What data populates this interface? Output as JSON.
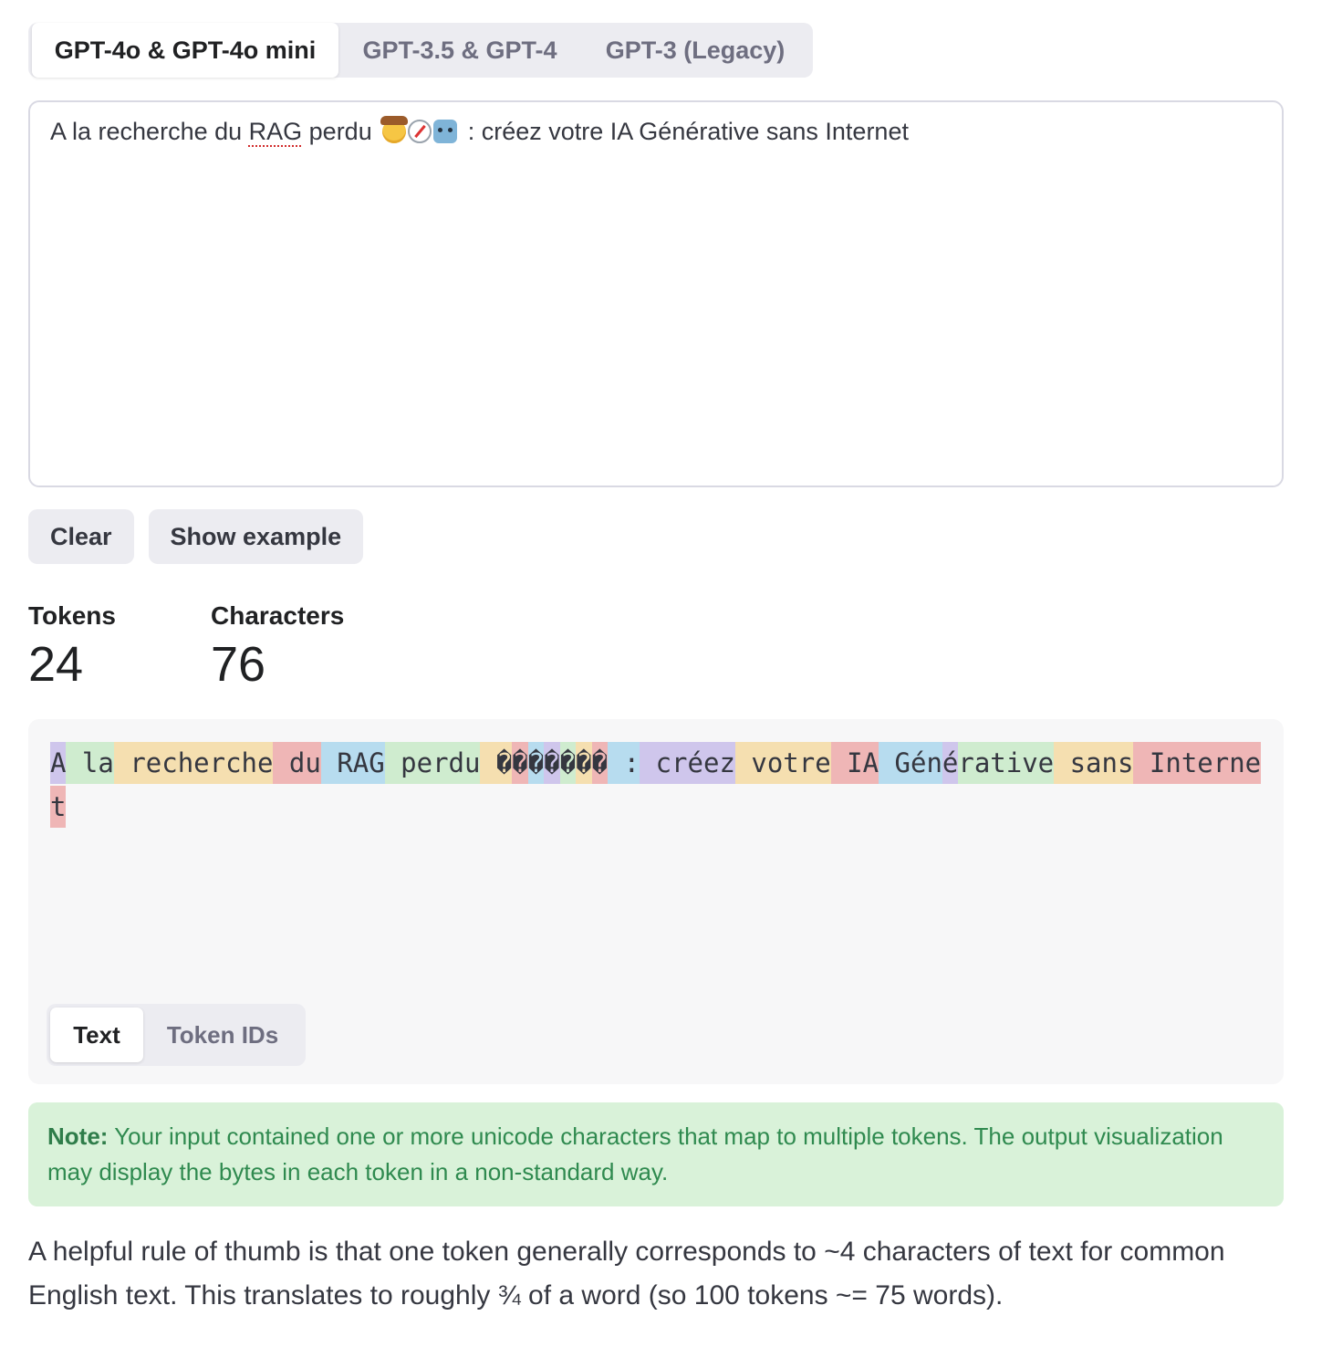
{
  "model_tabs": [
    {
      "label": "GPT-4o & GPT-4o mini",
      "active": true
    },
    {
      "label": "GPT-3.5 & GPT-4",
      "active": false
    },
    {
      "label": "GPT-3 (Legacy)",
      "active": false
    }
  ],
  "input": {
    "text_before": "A la recherche du ",
    "flagged_word": "RAG",
    "text_mid": " perdu ",
    "emojis": [
      "cowboy-hat-face",
      "compass",
      "robot"
    ],
    "text_after": " : créez votre IA Générative sans Internet"
  },
  "buttons": {
    "clear": "Clear",
    "show_example": "Show example"
  },
  "stats": {
    "tokens_label": "Tokens",
    "tokens_value": "24",
    "characters_label": "Characters",
    "characters_value": "76"
  },
  "token_colors": [
    "#cfc6ec",
    "#cfeccf",
    "#f5dfb0",
    "#efb6b6",
    "#b7dcef"
  ],
  "tokens": [
    {
      "text": "A",
      "color": 0
    },
    {
      "text": " la",
      "color": 1
    },
    {
      "text": " recherche",
      "color": 2
    },
    {
      "text": " du",
      "color": 3
    },
    {
      "text": " RAG",
      "color": 4
    },
    {
      "text": " perdu",
      "color": 1
    },
    {
      "text": " ",
      "color": 2
    },
    {
      "text": "�",
      "color": 2
    },
    {
      "text": "�",
      "color": 3
    },
    {
      "text": "�",
      "color": 4
    },
    {
      "text": "�",
      "color": 0
    },
    {
      "text": "�",
      "color": 1
    },
    {
      "text": "�",
      "color": 2
    },
    {
      "text": "�",
      "color": 3
    },
    {
      "text": " :",
      "color": 4
    },
    {
      "text": " créez",
      "color": 0
    },
    {
      "text": " votre",
      "color": 2
    },
    {
      "text": " IA",
      "color": 3
    },
    {
      "text": " Gén",
      "color": 4
    },
    {
      "text": "é",
      "color": 0
    },
    {
      "text": "rative",
      "color": 1
    },
    {
      "text": " sans",
      "color": 2
    },
    {
      "text": " Internet",
      "color": 3
    }
  ],
  "view_tabs": [
    {
      "label": "Text",
      "active": true
    },
    {
      "label": "Token IDs",
      "active": false
    }
  ],
  "note": {
    "label": "Note:",
    "text": " Your input contained one or more unicode characters that map to multiple tokens. The output visualization may display the bytes in each token in a non-standard way."
  },
  "rule_of_thumb": "A helpful rule of thumb is that one token generally corresponds to ~4 characters of text for common English text. This translates to roughly ¾ of a word (so 100 tokens ~= 75 words)."
}
